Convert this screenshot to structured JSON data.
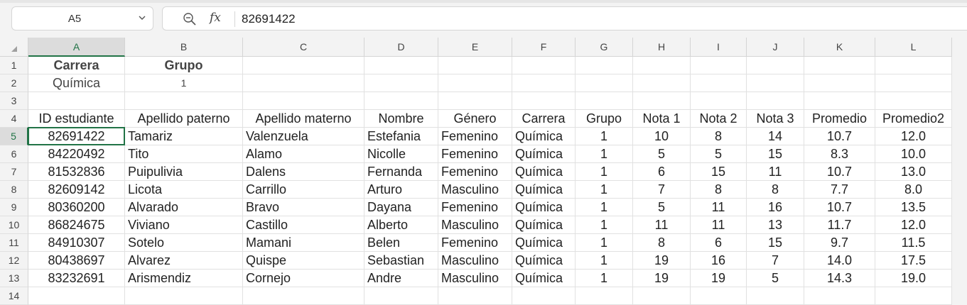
{
  "name_box": {
    "value": "A5"
  },
  "formula_bar": {
    "fx_label": "fx",
    "content": "82691422"
  },
  "columns": [
    "A",
    "B",
    "C",
    "D",
    "E",
    "F",
    "G",
    "H",
    "I",
    "J",
    "K",
    "L"
  ],
  "rows": [
    "1",
    "2",
    "3",
    "4",
    "5",
    "6",
    "7",
    "8",
    "9",
    "10",
    "11",
    "12",
    "13",
    "14"
  ],
  "active_cell": "A5",
  "cells": {
    "A1": "Carrera",
    "B1": "Grupo",
    "A2": "Química",
    "B2": "1",
    "A4": "ID estudiante",
    "B4": "Apellido paterno",
    "C4": "Apellido materno",
    "D4": "Nombre",
    "E4": "Género",
    "F4": "Carrera",
    "G4": "Grupo",
    "H4": "Nota 1",
    "I4": "Nota 2",
    "J4": "Nota 3",
    "K4": "Promedio",
    "L4": "Promedio2",
    "A5": "82691422",
    "B5": "Tamariz",
    "C5": "Valenzuela",
    "D5": "Estefania",
    "E5": "Femenino",
    "F5": "Química",
    "G5": "1",
    "H5": "10",
    "I5": "8",
    "J5": "14",
    "K5": "10.7",
    "L5": "12.0",
    "A6": "84220492",
    "B6": "Tito",
    "C6": "Alamo",
    "D6": "Nicolle",
    "E6": "Femenino",
    "F6": "Química",
    "G6": "1",
    "H6": "5",
    "I6": "5",
    "J6": "15",
    "K6": "8.3",
    "L6": "10.0",
    "A7": "81532836",
    "B7": "Puipulivia",
    "C7": "Dalens",
    "D7": "Fernanda",
    "E7": "Femenino",
    "F7": "Química",
    "G7": "1",
    "H7": "6",
    "I7": "15",
    "J7": "11",
    "K7": "10.7",
    "L7": "13.0",
    "A8": "82609142",
    "B8": "Licota",
    "C8": "Carrillo",
    "D8": "Arturo",
    "E8": "Masculino",
    "F8": "Química",
    "G8": "1",
    "H8": "7",
    "I8": "8",
    "J8": "8",
    "K8": "7.7",
    "L8": "8.0",
    "A9": "80360200",
    "B9": "Alvarado",
    "C9": "Bravo",
    "D9": "Dayana",
    "E9": "Femenino",
    "F9": "Química",
    "G9": "1",
    "H9": "5",
    "I9": "11",
    "J9": "16",
    "K9": "10.7",
    "L9": "13.5",
    "A10": "86824675",
    "B10": "Viviano",
    "C10": "Castillo",
    "D10": "Alberto",
    "E10": "Masculino",
    "F10": "Química",
    "G10": "1",
    "H10": "11",
    "I10": "11",
    "J10": "13",
    "K10": "11.7",
    "L10": "12.0",
    "A11": "84910307",
    "B11": "Sotelo",
    "C11": "Mamani",
    "D11": "Belen",
    "E11": "Femenino",
    "F11": "Química",
    "G11": "1",
    "H11": "8",
    "I11": "6",
    "J11": "15",
    "K11": "9.7",
    "L11": "11.5",
    "A12": "80438697",
    "B12": "Alvarez",
    "C12": "Quispe",
    "D12": "Sebastian",
    "E12": "Masculino",
    "F12": "Química",
    "G12": "1",
    "H12": "19",
    "I12": "16",
    "J12": "7",
    "K12": "14.0",
    "L12": "17.5",
    "A13": "83232691",
    "B13": "Arismendiz",
    "C13": "Cornejo",
    "D13": "Andre",
    "E13": "Masculino",
    "F13": "Química",
    "G13": "1",
    "H13": "19",
    "I13": "19",
    "J13": "5",
    "K13": "14.3",
    "L13": "19.0"
  }
}
